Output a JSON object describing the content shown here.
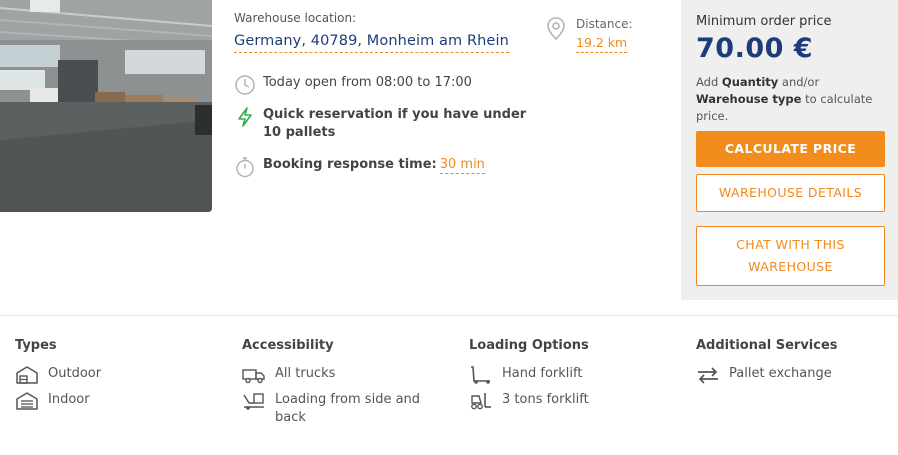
{
  "location": {
    "label": "Warehouse location:",
    "value": "Germany, 40789, Monheim am Rhein"
  },
  "distance": {
    "label": "Distance:",
    "value": "19.2 km"
  },
  "features": {
    "open_hours": "Today open from 08:00 to 17:00",
    "quick_reservation": "Quick reservation if you have under 10 pallets",
    "response_label": "Booking response time:",
    "response_value": "30 min"
  },
  "pricing": {
    "min_label": "Minimum order price",
    "price": "70.00 €",
    "note_prefix": "Add ",
    "note_quantity": "Quantity",
    "note_mid": " and/or ",
    "note_type": "Warehouse type",
    "note_suffix": " to calculate price."
  },
  "buttons": {
    "calculate": "CALCULATE PRICE",
    "details": "WAREHOUSE DETAILS",
    "chat": "CHAT WITH THIS WAREHOUSE"
  },
  "sections": {
    "types": {
      "title": "Types",
      "items": [
        "Outdoor",
        "Indoor"
      ]
    },
    "accessibility": {
      "title": "Accessibility",
      "items": [
        "All trucks",
        "Loading from side and back"
      ]
    },
    "loading": {
      "title": "Loading Options",
      "items": [
        "Hand forklift",
        "3 tons forklift"
      ]
    },
    "services": {
      "title": "Additional Services",
      "items": [
        "Pallet exchange"
      ]
    }
  },
  "colors": {
    "accent": "#f28c1a",
    "primary": "#1f3c7a",
    "panel": "#efefef"
  }
}
